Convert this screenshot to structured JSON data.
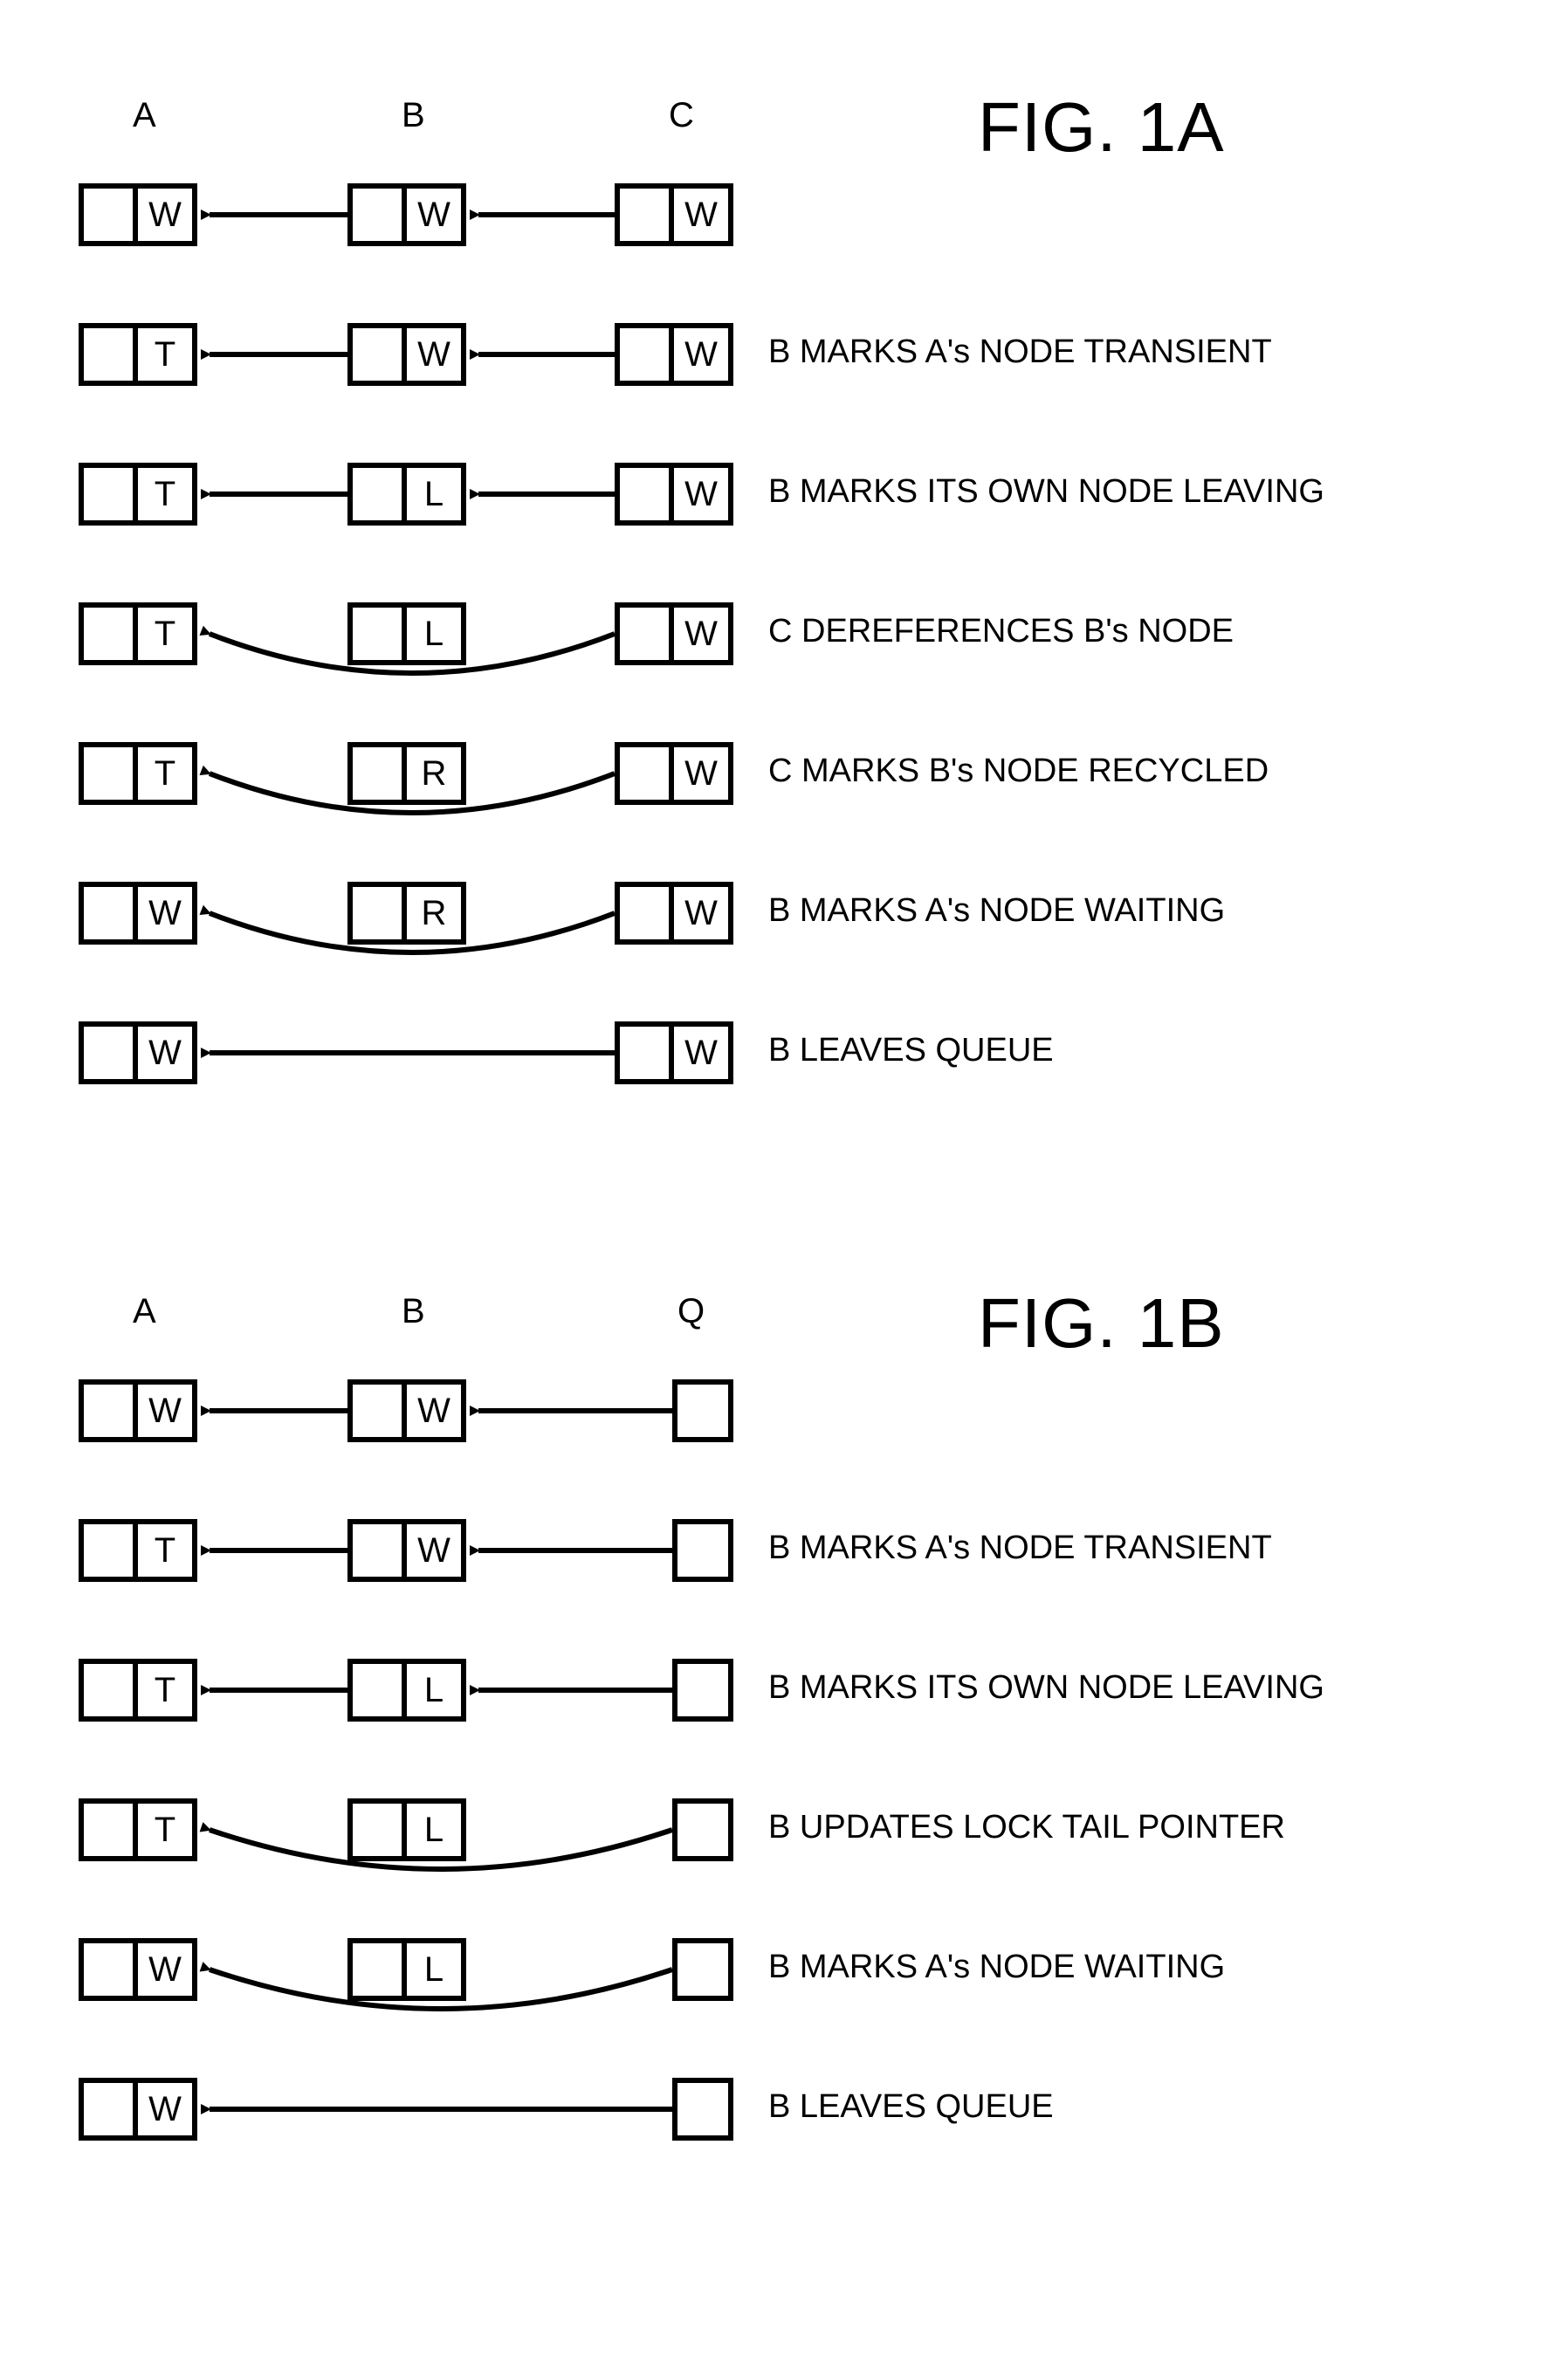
{
  "fig1a": {
    "title": "FIG. 1A",
    "headers": {
      "A": "A",
      "B": "B",
      "C": "C"
    },
    "rows": [
      {
        "A": "W",
        "B": "W",
        "C": "W",
        "caption": "",
        "link_ab": "straight",
        "link_bc": "straight",
        "b_present": true
      },
      {
        "A": "T",
        "B": "W",
        "C": "W",
        "caption": "B MARKS A's NODE TRANSIENT",
        "link_ab": "straight",
        "link_bc": "straight",
        "b_present": true
      },
      {
        "A": "T",
        "B": "L",
        "C": "W",
        "caption": "B MARKS ITS OWN NODE LEAVING",
        "link_ab": "straight",
        "link_bc": "straight",
        "b_present": true
      },
      {
        "A": "T",
        "B": "L",
        "C": "W",
        "caption": "C DEREFERENCES B's NODE",
        "link_ab": "none",
        "link_bc": "curve",
        "b_present": true
      },
      {
        "A": "T",
        "B": "R",
        "C": "W",
        "caption": "C MARKS B's NODE RECYCLED",
        "link_ab": "none",
        "link_bc": "curve",
        "b_present": true
      },
      {
        "A": "W",
        "B": "R",
        "C": "W",
        "caption": "B MARKS A's NODE WAITING",
        "link_ab": "none",
        "link_bc": "curve",
        "b_present": true
      },
      {
        "A": "W",
        "B": "",
        "C": "W",
        "caption": "B LEAVES QUEUE",
        "link_ab": "none",
        "link_bc": "long",
        "b_present": false
      }
    ]
  },
  "fig1b": {
    "title": "FIG. 1B",
    "headers": {
      "A": "A",
      "B": "B",
      "Q": "Q"
    },
    "rows": [
      {
        "A": "W",
        "B": "W",
        "caption": "",
        "link_ab": "straight",
        "link_bq": "straight",
        "b_present": true
      },
      {
        "A": "T",
        "B": "W",
        "caption": "B MARKS A's NODE TRANSIENT",
        "link_ab": "straight",
        "link_bq": "straight",
        "b_present": true
      },
      {
        "A": "T",
        "B": "L",
        "caption": "B MARKS ITS OWN NODE LEAVING",
        "link_ab": "straight",
        "link_bq": "straight",
        "b_present": true
      },
      {
        "A": "T",
        "B": "L",
        "caption": "B UPDATES LOCK TAIL POINTER",
        "link_ab": "none",
        "link_bq": "curve",
        "b_present": true
      },
      {
        "A": "W",
        "B": "L",
        "caption": "B MARKS A's NODE WAITING",
        "link_ab": "none",
        "link_bq": "curve",
        "b_present": true
      },
      {
        "A": "W",
        "B": "",
        "caption": "B LEAVES QUEUE",
        "link_ab": "none",
        "link_bq": "long",
        "b_present": false
      }
    ]
  }
}
